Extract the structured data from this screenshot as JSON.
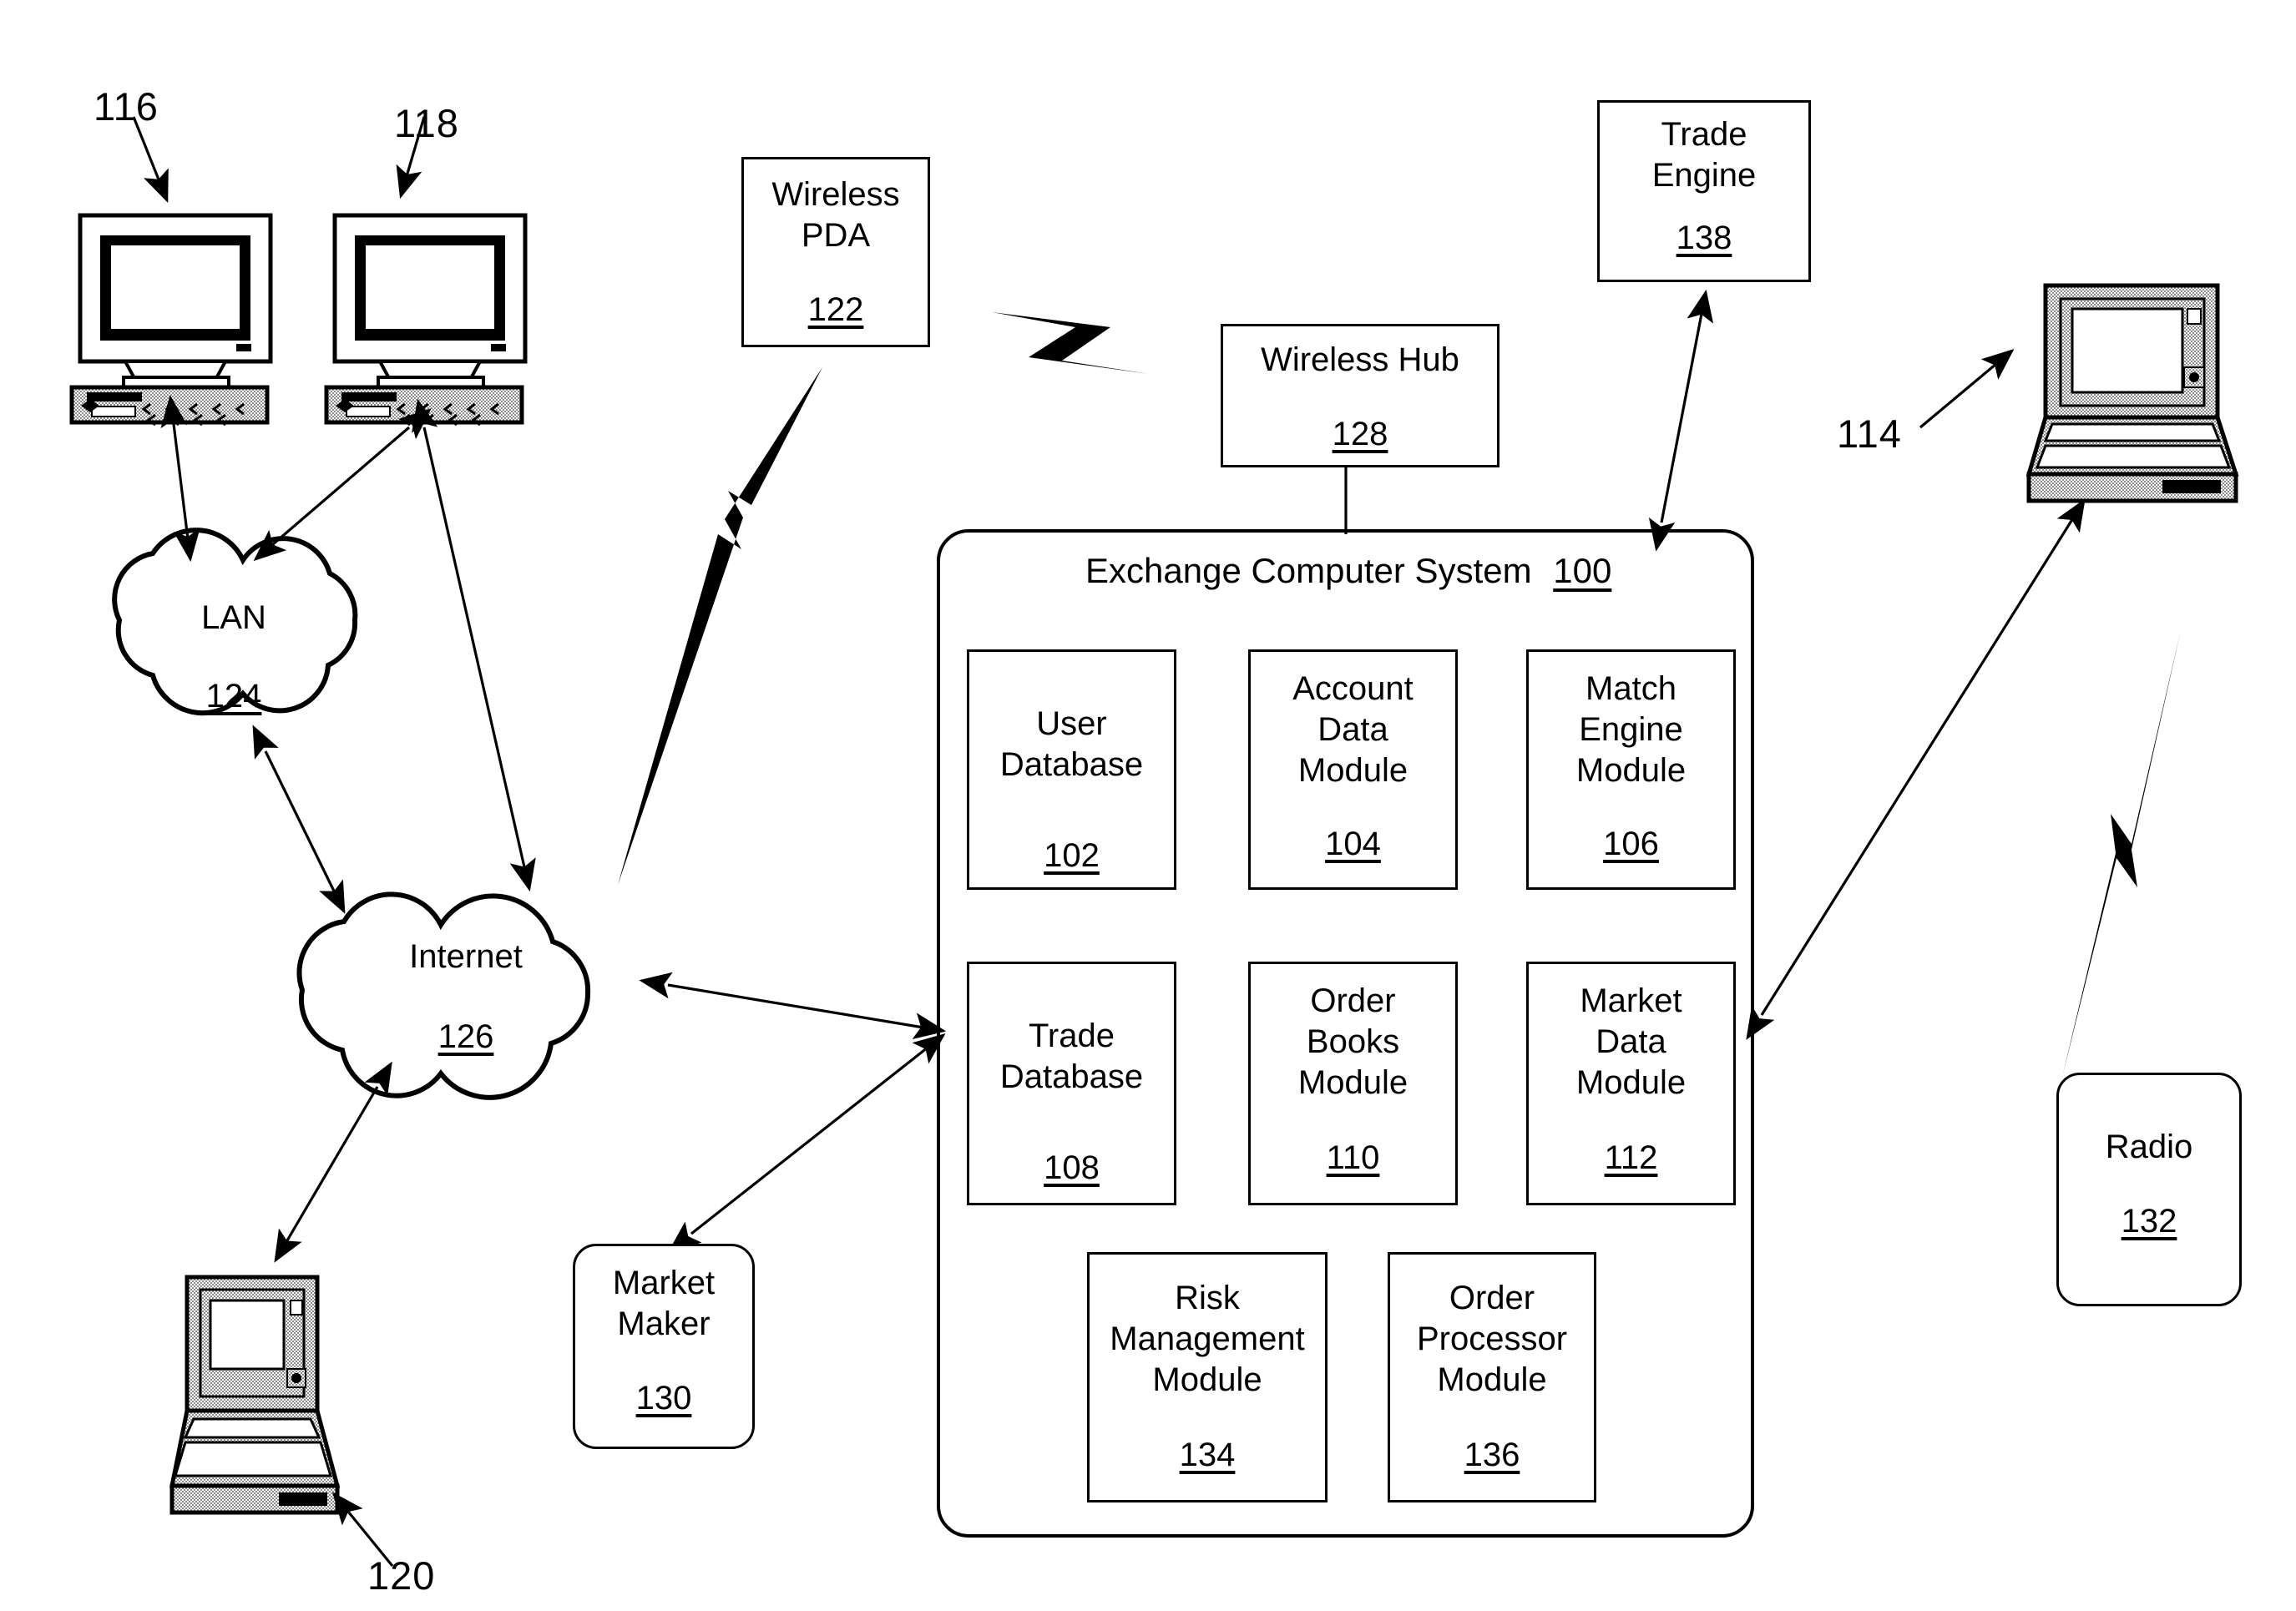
{
  "figure": {
    "title": "Exchange Computer System network block diagram",
    "system": {
      "label": "Exchange Computer System",
      "ref": "100"
    }
  },
  "modules": [
    {
      "name": "User\nDatabase",
      "ref": "102",
      "row": 1,
      "col": 1
    },
    {
      "name": "Account\nData\nModule",
      "ref": "104",
      "row": 1,
      "col": 2
    },
    {
      "name": "Match\nEngine\nModule",
      "ref": "106",
      "row": 1,
      "col": 3
    },
    {
      "name": "Trade\nDatabase",
      "ref": "108",
      "row": 2,
      "col": 1
    },
    {
      "name": "Order\nBooks\nModule",
      "ref": "110",
      "row": 2,
      "col": 2
    },
    {
      "name": "Market\nData\nModule",
      "ref": "112",
      "row": 2,
      "col": 3
    },
    {
      "name": "Risk\nManagement\nModule",
      "ref": "134",
      "row": 3,
      "col": 1
    },
    {
      "name": "Order\nProcessor\nModule",
      "ref": "136",
      "row": 3,
      "col": 2
    }
  ],
  "nodes": [
    {
      "key": "wireless_pda",
      "label": "Wireless\nPDA",
      "ref": "122",
      "shape": "rect"
    },
    {
      "key": "wireless_hub",
      "label": "Wireless Hub",
      "ref": "128",
      "shape": "rect"
    },
    {
      "key": "trade_engine",
      "label": "Trade\nEngine",
      "ref": "138",
      "shape": "rect"
    },
    {
      "key": "market_maker",
      "label": "Market\nMaker",
      "ref": "130",
      "shape": "rounded"
    },
    {
      "key": "radio",
      "label": "Radio",
      "ref": "132",
      "shape": "rounded"
    }
  ],
  "clouds": [
    {
      "key": "lan",
      "label": "LAN",
      "ref": "124"
    },
    {
      "key": "internet",
      "label": "Internet",
      "ref": "126"
    }
  ],
  "devices": [
    {
      "key": "workstation_116",
      "type": "desktop-computer",
      "ref": "116"
    },
    {
      "key": "workstation_118",
      "type": "desktop-computer",
      "ref": "118"
    },
    {
      "key": "laptop_120",
      "type": "laptop-computer",
      "ref": "120"
    },
    {
      "key": "laptop_114",
      "type": "laptop-computer",
      "ref": "114"
    }
  ],
  "wireless_links": [
    {
      "key": "pda-to-internet",
      "icon": "lightning-bolt-icon"
    },
    {
      "key": "pda-to-hub",
      "icon": "lightning-bolt-icon"
    },
    {
      "key": "radio-to-laptop",
      "icon": "lightning-bolt-icon"
    }
  ],
  "colors": {
    "ink": "#000000",
    "paper": "#ffffff",
    "shade": "#a8a8a8"
  }
}
